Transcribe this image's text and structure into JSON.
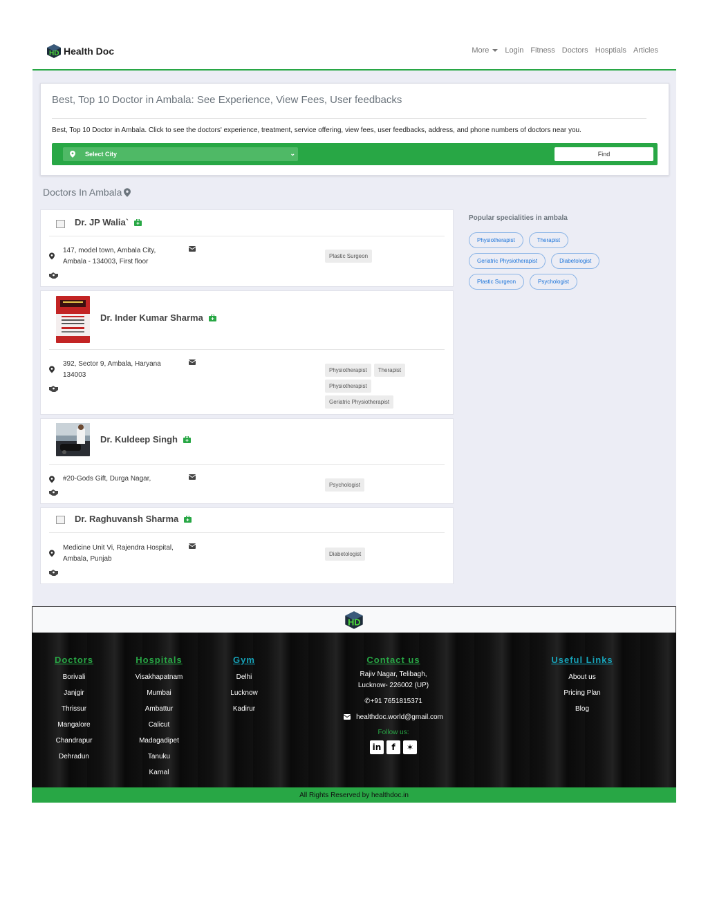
{
  "nav": {
    "brand": "Health Doc",
    "links": [
      "More",
      "Login",
      "Fitness",
      "Doctors",
      "Hosptials",
      "Articles"
    ]
  },
  "hero": {
    "title": "Best, Top 10 Doctor in Ambala: See Experience, View Fees, User feedbacks",
    "description": "Best, Top 10 Doctor in Ambala. Click to see the doctors' experience, treatment, service offering, view fees, user feedbacks, address, and phone numbers of doctors near you.",
    "select_placeholder": "Select City",
    "find_label": "Find"
  },
  "section_title": "Doctors In Ambala",
  "doctors": [
    {
      "name": "Dr. JP Walia`",
      "address": "147, model town, Ambala City, Ambala - 134003, First floor",
      "tags": [
        "Plastic Surgeon"
      ]
    },
    {
      "name": "Dr. Inder Kumar Sharma",
      "address": "392, Sector 9, Ambala, Haryana 134003",
      "tags": [
        "Physiotherapist",
        "Therapist",
        "Physiotherapist",
        "Geriatric Physiotherapist"
      ]
    },
    {
      "name": "Dr. Kuldeep Singh",
      "address": "#20-Gods Gift, Durga Nagar,",
      "tags": [
        "Psychologist"
      ]
    },
    {
      "name": "Dr. Raghuvansh Sharma",
      "address": "Medicine Unit Vi, Rajendra Hospital, Ambala, Punjab",
      "tags": [
        "Diabetologist"
      ]
    }
  ],
  "popular": {
    "title": "Popular specialities in ambala",
    "items": [
      "Physiotherapist",
      "Therapist",
      "Geriatric Physiotherapist",
      "Diabetologist",
      "Plastic Surgeon",
      "Psychologist"
    ]
  },
  "footer": {
    "doctors": {
      "title": "Doctors",
      "items": [
        "Borivali",
        "Janjgir",
        "Thrissur",
        "Mangalore",
        "Chandrapur",
        "Dehradun"
      ]
    },
    "hospitals": {
      "title": "Hospitals",
      "items": [
        "Visakhapatnam",
        "Mumbai",
        "Ambattur",
        "Calicut",
        "Madagadipet",
        "Tanuku",
        "Karnal"
      ]
    },
    "gym": {
      "title": "Gym",
      "items": [
        "Delhi",
        "Lucknow",
        "Kadirur"
      ]
    },
    "contact": {
      "title": "Contact us",
      "address_line1": "Rajiv Nagar, Telibagh,",
      "address_line2": "Lucknow- 226002 (UP)",
      "phone": "+91 7651815371",
      "email": "healthdoc.world@gmail.com",
      "follow": "Follow us:"
    },
    "useful": {
      "title": "Useful Links",
      "items": [
        "About us",
        "Pricing Plan",
        "Blog"
      ]
    },
    "copyright": "All Rights Reserved by healthdoc.in"
  },
  "colors": {
    "accent": "#28a745",
    "link": "#1a73d9",
    "footer_bg": "#111111"
  }
}
